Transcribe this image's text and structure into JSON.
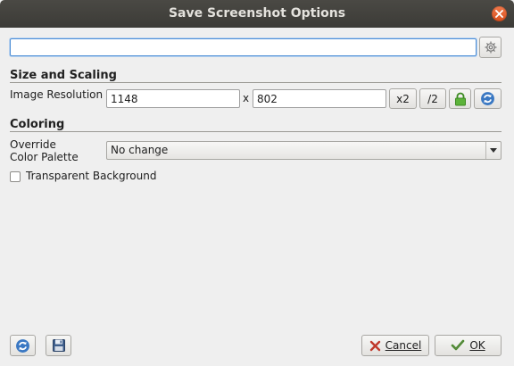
{
  "window": {
    "title": "Save Screenshot Options"
  },
  "filename": {
    "value": ""
  },
  "size_scaling": {
    "heading": "Size and Scaling",
    "resolution_label": "Image Resolution",
    "width_value": "1148",
    "separator": "x",
    "height_value": "802",
    "double_label": "x2",
    "half_label": "/2"
  },
  "coloring": {
    "heading": "Coloring",
    "palette_label_line1": "Override",
    "palette_label_line2": "Color Palette",
    "palette_selected": "No change",
    "transparent_label": "Transparent Background",
    "transparent_checked": false
  },
  "footer": {
    "cancel_label": "Cancel",
    "ok_label": "OK"
  },
  "icons": {
    "settings": "gear-icon",
    "lock": "lock-icon",
    "refresh": "refresh-icon",
    "save": "floppy-disk-icon",
    "cancel": "x-icon",
    "ok": "checkmark-icon",
    "close": "close-icon"
  },
  "colors": {
    "titlebar": "#3c3b37",
    "close_button": "#e2632f",
    "focus_border": "#4f8fd6",
    "lock_green": "#4aa02c",
    "refresh_blue": "#3a78c3"
  }
}
